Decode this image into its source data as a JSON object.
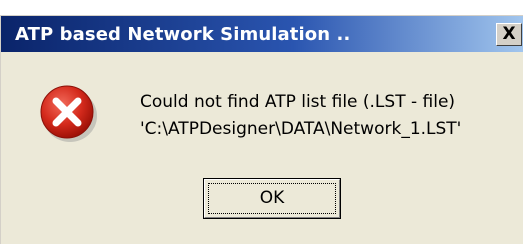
{
  "dialog": {
    "title": "ATP based Network Simulation ..",
    "close_label": "X",
    "icon": "error-icon",
    "message_line1": "Could not find ATP list file (.LST - file)",
    "message_line2": "'C:\\ATPDesigner\\DATA\\Network_1.LST'",
    "ok_label": "OK"
  },
  "colors": {
    "titlebar_start": "#0a246a",
    "titlebar_end": "#a6caf0",
    "dialog_bg": "#ece9d8",
    "error_red": "#d42a1c"
  }
}
